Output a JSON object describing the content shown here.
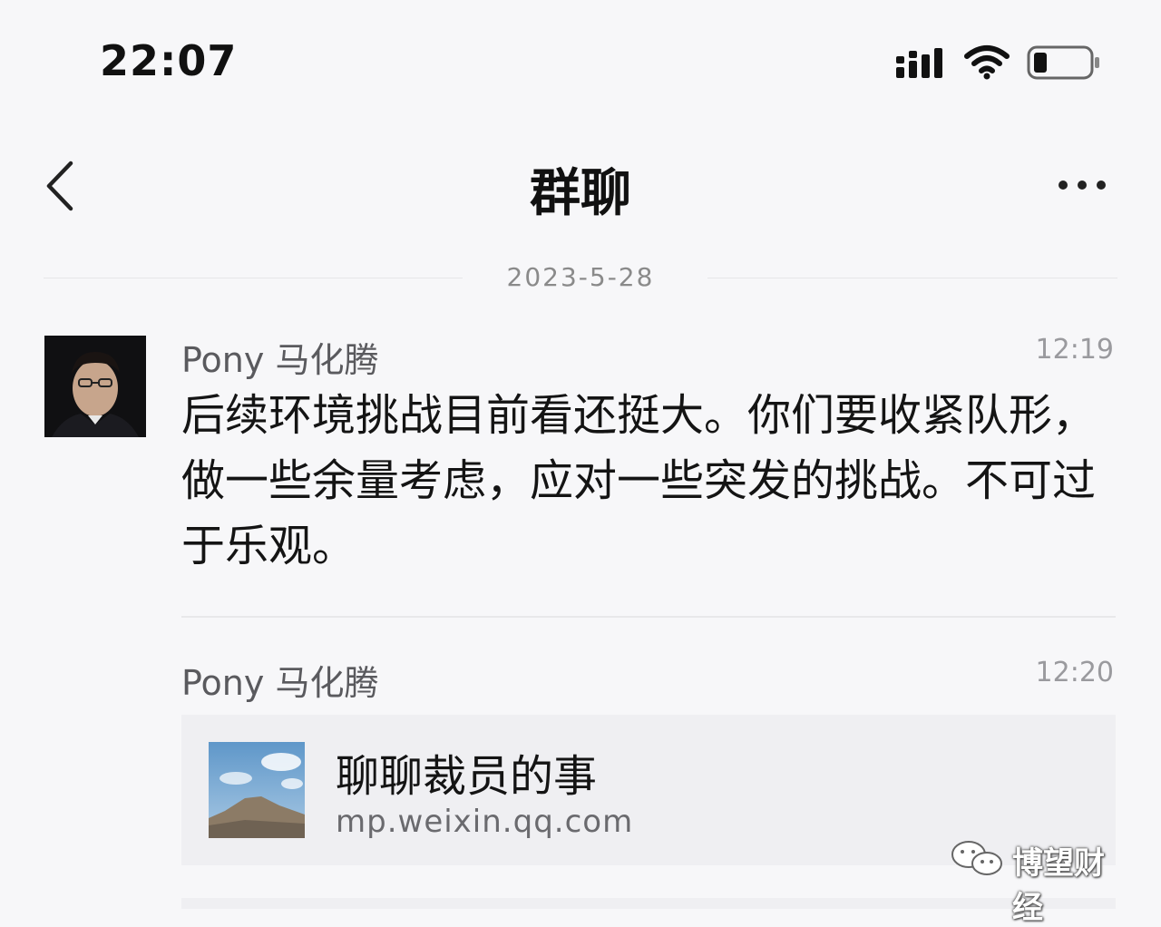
{
  "status_bar": {
    "time": "22:07"
  },
  "nav": {
    "title": "群聊"
  },
  "date_divider": "2023-5-28",
  "messages": [
    {
      "sender": "Pony 马化腾",
      "time": "12:19",
      "text": "后续环境挑战目前看还挺大。你们要收紧队形，做一些余量考虑，应对一些突发的挑战。不可过于乐观。"
    },
    {
      "sender": "Pony 马化腾",
      "time": "12:20",
      "link": {
        "title": "聊聊裁员的事",
        "url": "mp.weixin.qq.com"
      }
    }
  ],
  "watermark": "博望财经",
  "icons": [
    "back-chevron-icon",
    "more-dots-icon",
    "signal-icon",
    "wifi-icon",
    "battery-icon",
    "wechat-logo-icon"
  ]
}
